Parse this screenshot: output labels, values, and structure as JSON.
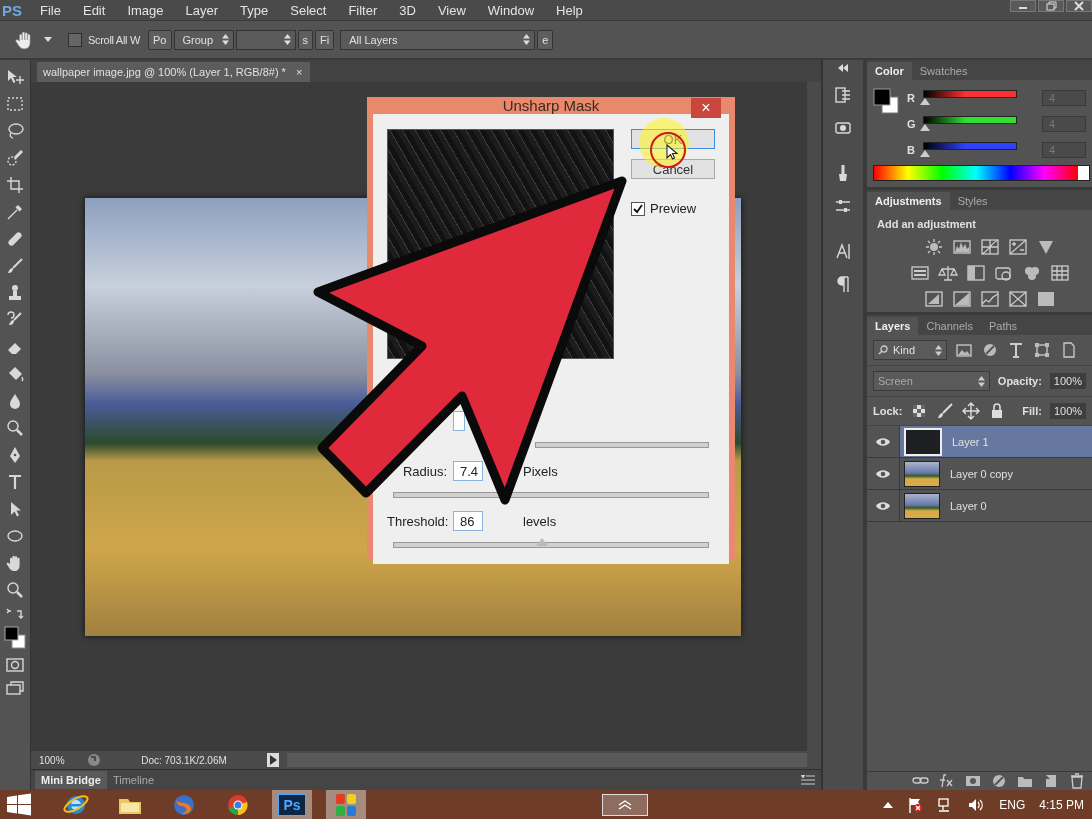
{
  "app": {
    "logo": "PS"
  },
  "menu": [
    "File",
    "Edit",
    "Image",
    "Layer",
    "Type",
    "Select",
    "Filter",
    "3D",
    "View",
    "Window",
    "Help"
  ],
  "options_bar": {
    "scroll_all": {
      "label": "Scroll All W",
      "checked": false
    },
    "controls": [
      {
        "kind": "button",
        "label": "Po"
      },
      {
        "kind": "select",
        "label": "Group"
      },
      {
        "kind": "select"
      },
      {
        "kind": "button",
        "label": "s"
      },
      {
        "kind": "button",
        "label": "Fi"
      },
      {
        "kind": "wide_select",
        "label": "All Layers"
      },
      {
        "kind": "button",
        "label": "e"
      }
    ]
  },
  "document": {
    "tab": {
      "title": "wallpaper image.jpg @ 100% (Layer 1, RGB/8#) *",
      "close": "×"
    },
    "zoom": "100%",
    "doc_info": "Doc: 703.1K/2.06M"
  },
  "bottom_tabs": [
    {
      "label": "Mini Bridge",
      "selected": true
    },
    {
      "label": "Timeline",
      "selected": false
    }
  ],
  "dialog": {
    "title": "Unsharp Mask",
    "close": "×",
    "buttons": [
      {
        "label": "OK",
        "kind": "default"
      },
      {
        "label": "Cancel",
        "kind": "normal"
      }
    ],
    "preview": {
      "label": "Preview",
      "checked": true
    },
    "fields": [
      {
        "kind": "partial_field"
      },
      {
        "kind": "field",
        "label": "Radius:",
        "value": "7.4",
        "unit": "Pixels"
      },
      {
        "kind": "field",
        "label": "Threshold:",
        "value": "86",
        "unit": "levels",
        "level": 0.47
      }
    ]
  },
  "color_panel": {
    "tabs": [
      {
        "label": "Color",
        "selected": true
      },
      {
        "label": "Swatches",
        "selected": false
      }
    ],
    "channels": [
      {
        "name": "R",
        "value": "4",
        "level": 0.016,
        "color": "#ff3030"
      },
      {
        "name": "G",
        "value": "4",
        "level": 0.016,
        "color": "#30e030"
      },
      {
        "name": "B",
        "value": "4",
        "level": 0.016,
        "color": "#3040ff"
      }
    ]
  },
  "adjustments_panel": {
    "tabs": [
      {
        "label": "Adjustments",
        "selected": true
      },
      {
        "label": "Styles",
        "selected": false
      }
    ],
    "heading": "Add an adjustment"
  },
  "layers_panel": {
    "tabs": [
      {
        "label": "Layers",
        "selected": true
      },
      {
        "label": "Channels",
        "selected": false
      },
      {
        "label": "Paths",
        "selected": false
      }
    ],
    "filter": "Kind",
    "blend_mode": "Screen",
    "opacity_label": "Opacity:",
    "opacity": "100%",
    "lock_label": "Lock:",
    "fill_label": "Fill:",
    "fill": "100%",
    "layers": [
      {
        "name": "Layer 1",
        "visible": true,
        "selected": true,
        "kind": "dark"
      },
      {
        "name": "Layer 0 copy",
        "visible": true,
        "selected": false,
        "kind": "landscape"
      },
      {
        "name": "Layer 0",
        "visible": true,
        "selected": false,
        "kind": "landscape"
      }
    ]
  },
  "taskbar": {
    "apps": [
      {
        "kind": "ie",
        "selected": false
      },
      {
        "kind": "folder",
        "selected": false
      },
      {
        "kind": "firefox",
        "selected": false
      },
      {
        "kind": "chrome",
        "selected": false
      },
      {
        "kind": "photoshop",
        "label": "Ps",
        "selected": true
      },
      {
        "kind": "tiles",
        "selected": true
      }
    ],
    "language": "ENG",
    "time": "4:15 PM"
  }
}
